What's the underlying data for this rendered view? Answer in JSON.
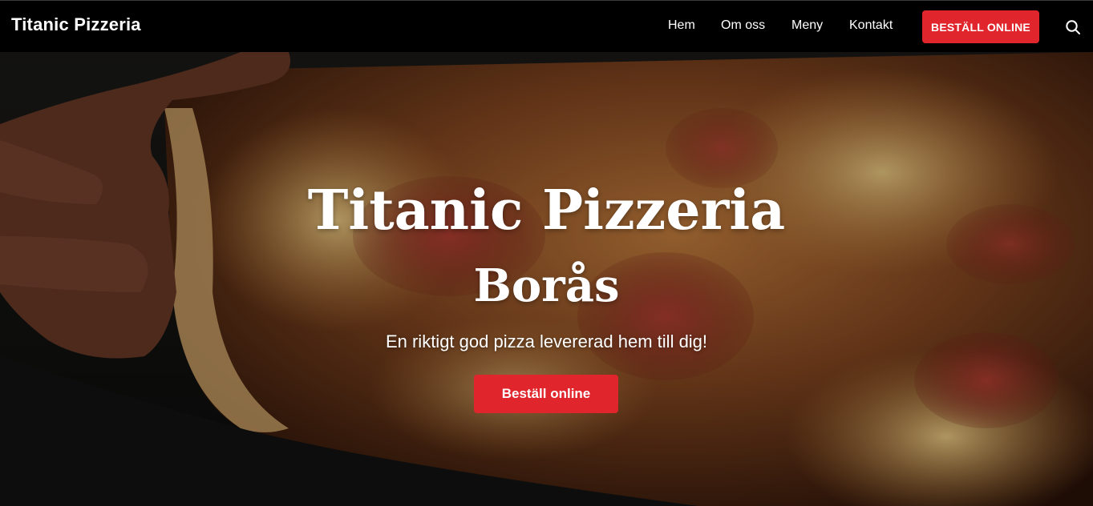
{
  "header": {
    "logo": "Titanic Pizzeria",
    "nav": {
      "hem": "Hem",
      "om_oss": "Om oss",
      "meny": "Meny",
      "kontakt": "Kontakt"
    },
    "cta_label": "BESTÄLL ONLINE",
    "search_icon": "search-icon"
  },
  "hero": {
    "title": "Titanic Pizzeria",
    "subtitle": "Borås",
    "tagline": "En riktigt god pizza levererad hem till dig!",
    "cta_label": "Beställ online"
  },
  "colors": {
    "accent": "#e0252c",
    "header_bg": "#000000",
    "text": "#ffffff"
  }
}
